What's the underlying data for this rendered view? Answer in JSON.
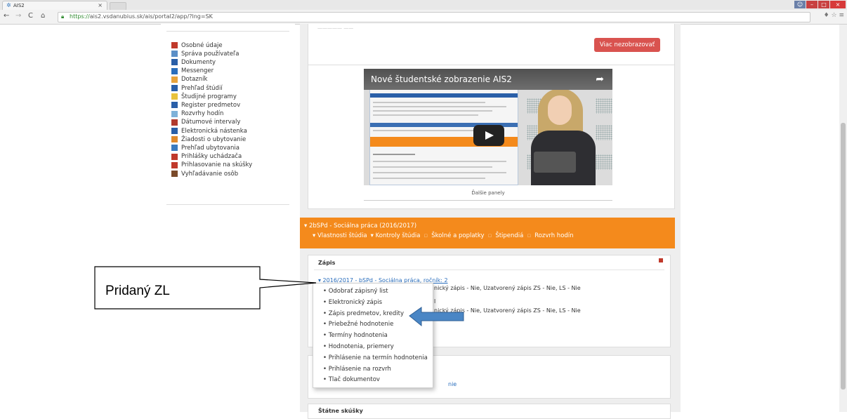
{
  "browser": {
    "tab_title": "AIS2",
    "tab_close": "×",
    "url_https": "https://",
    "url_rest": "ais2.vsdanubius.sk/ais/portal2/app/?lng=SK",
    "window_min": "–",
    "window_max": "□",
    "window_close": "×"
  },
  "sidebar": {
    "items": [
      {
        "label": "Osobné údaje",
        "color": "#c0392b"
      },
      {
        "label": "Správa používateľa",
        "color": "#5b8fc7"
      },
      {
        "label": "Dokumenty",
        "color": "#2a5fa8"
      },
      {
        "label": "Messenger",
        "color": "#2a6ebd"
      },
      {
        "label": "Dotazník",
        "color": "#e8a33c"
      },
      {
        "label": "Prehľad štúdií",
        "color": "#2a5fa8"
      },
      {
        "label": "Študijné programy",
        "color": "#e8c23c"
      },
      {
        "label": "Register predmetov",
        "color": "#2a5fa8"
      },
      {
        "label": "Rozvrhy hodín",
        "color": "#7fb2d9"
      },
      {
        "label": "Dátumové intervaly",
        "color": "#b03a2e"
      },
      {
        "label": "Elektronická nástenka",
        "color": "#2a5fa8"
      },
      {
        "label": "Žiadosti o ubytovanie",
        "color": "#e08a2c"
      },
      {
        "label": "Prehľad ubytovania",
        "color": "#3a7bbf"
      },
      {
        "label": "Prihlášky uchádzača",
        "color": "#c0392b"
      },
      {
        "label": "Prihlasovanie na skúšky",
        "color": "#c0392b"
      },
      {
        "label": "Vyhľadávanie osôb",
        "color": "#7a4a2a"
      }
    ]
  },
  "notice": {
    "button": "Viac nezobrazovať"
  },
  "video": {
    "title": "Nové študentské zobrazenie AIS2",
    "caption": "Ďalšie panely"
  },
  "study": {
    "title": "▾ 2bSPd - Sociálna práca (2016/2017)",
    "links": [
      "▾ Vlastnosti štúdia",
      "▾ Kontroly štúdia",
      "Školné a poplatky",
      "Štipendiá",
      "Rozvrh hodín"
    ],
    "link_sep": "▫"
  },
  "zapis": {
    "title": "Zápis",
    "zl_link": "▾ 2016/2017 - bSPd - Sociálna práca, ročník: 2",
    "row1_tail": "nický zápis - Nie, Uzatvorený zápis ZS - Nie, LS - Nie",
    "row2_mid": "l",
    "row3_tail": "nický zápis - Nie, Uzatvorený zápis ZS - Nie, LS - Nie"
  },
  "dropdown": {
    "items": [
      "• Odobrať zápisný list",
      "• Elektronický zápis",
      "• Zápis predmetov, kredity",
      "• Priebežné hodnotenie",
      "• Termíny hodnotenia",
      "• Hodnotenia, priemery",
      "• Prihlásenie na termín hodnotenia",
      "• Prihlásenie na rozvrh",
      "• Tlač dokumentov"
    ]
  },
  "panel2": {
    "fragment": "nie"
  },
  "panel3": {
    "title": "Štátne skúšky"
  },
  "callout": {
    "label": "Pridaný ZL"
  }
}
